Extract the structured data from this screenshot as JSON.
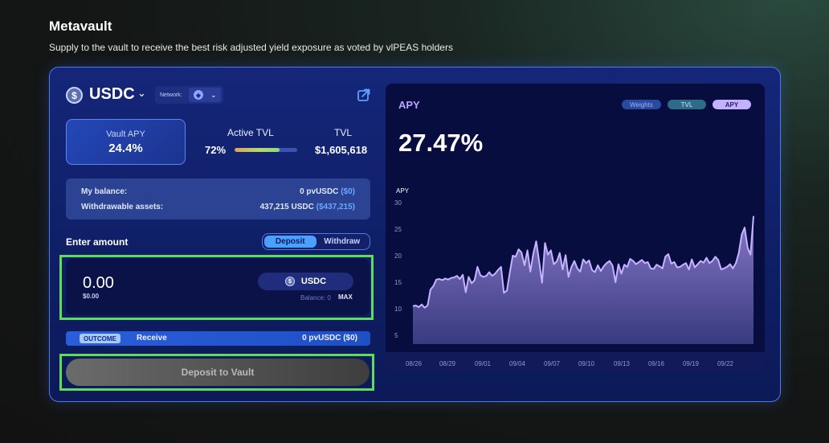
{
  "page": {
    "title": "Metavault",
    "subtitle": "Supply to the vault to receive the best risk adjusted yield exposure as voted by vlPEAS holders"
  },
  "vault": {
    "token": "USDC",
    "network_label": "Network:",
    "vault_apy_label": "Vault APY",
    "vault_apy": "24.4%",
    "active_tvl_label": "Active TVL",
    "active_tvl_pct": "72%",
    "active_tvl_fraction": 0.72,
    "tvl_label": "TVL",
    "tvl_value": "$1,605,618"
  },
  "balances": {
    "my_balance_label": "My balance:",
    "my_balance_value": "0 pvUSDC",
    "my_balance_usd": "($0)",
    "withdrawable_label": "Withdrawable assets:",
    "withdrawable_value": "437,215 USDC",
    "withdrawable_usd": "($437,215)"
  },
  "form": {
    "enter_amount_label": "Enter amount",
    "mode_options": [
      "Deposit",
      "Withdraw"
    ],
    "active_mode": "Deposit",
    "amount_value": "0.00",
    "amount_usd": "$0.00",
    "token": "USDC",
    "balance_hint": "Balance: 0",
    "max_label": "MAX",
    "outcome_badge": "OUTCOME",
    "receive_label": "Receive",
    "receive_value": "0 pvUSDC ($0)",
    "submit_label": "Deposit to Vault"
  },
  "chart_panel": {
    "title": "APY",
    "tabs": [
      "Weights",
      "TVL",
      "APY"
    ],
    "active_tab": "APY",
    "current_value": "27.47%"
  },
  "colors": {
    "accent": "#4a7be8",
    "highlight": "#5fdc5b",
    "chart_line": "#c7b3ff",
    "active_toggle": "#4aa0ff"
  },
  "chart_data": {
    "type": "area",
    "ylabel": "APY",
    "ylim": [
      3,
      33
    ],
    "yticks": [
      5,
      10,
      15,
      20,
      25,
      30
    ],
    "xtick_labels": [
      "08/26",
      "08/29",
      "09/01",
      "09/04",
      "09/07",
      "09/10",
      "09/13",
      "09/16",
      "09/19",
      "09/22"
    ],
    "x_start": "08/26",
    "x_end": "09/24",
    "values": [
      10.5,
      10.6,
      10.3,
      10.8,
      10.2,
      10.6,
      13.6,
      14.3,
      15.5,
      15.6,
      15.4,
      15.7,
      15.5,
      15.8,
      15.9,
      16.2,
      15.6,
      16.4,
      13.1,
      16.0,
      14.8,
      15.4,
      17.9,
      16.3,
      16.0,
      16.2,
      16.9,
      16.2,
      16.6,
      17.3,
      17.9,
      13.0,
      13.4,
      16.8,
      20.0,
      19.8,
      21.2,
      20.6,
      18.2,
      21.0,
      17.0,
      20.4,
      22.7,
      18.9,
      14.9,
      22.4,
      20.2,
      21.0,
      18.4,
      18.9,
      20.5,
      17.4,
      20.1,
      16.0,
      17.9,
      19.0,
      17.6,
      17.0,
      19.3,
      18.6,
      19.1,
      17.3,
      16.9,
      18.2,
      17.1,
      18.0,
      18.6,
      19.0,
      18.1,
      15.0,
      18.4,
      16.6,
      18.3,
      17.9,
      19.4,
      19.0,
      18.4,
      18.8,
      19.2,
      18.6,
      18.8,
      17.6,
      17.5,
      18.3,
      18.0,
      17.6,
      19.8,
      20.3,
      18.5,
      18.8,
      17.8,
      17.9,
      18.3,
      18.6,
      17.4,
      19.3,
      17.8,
      18.4,
      19.0,
      18.7,
      19.6,
      18.6,
      19.0,
      19.8,
      19.2,
      17.4,
      17.6,
      17.9,
      18.4,
      17.6,
      18.6,
      20.5,
      24.0,
      25.3,
      21.5,
      20.2,
      27.47
    ]
  }
}
